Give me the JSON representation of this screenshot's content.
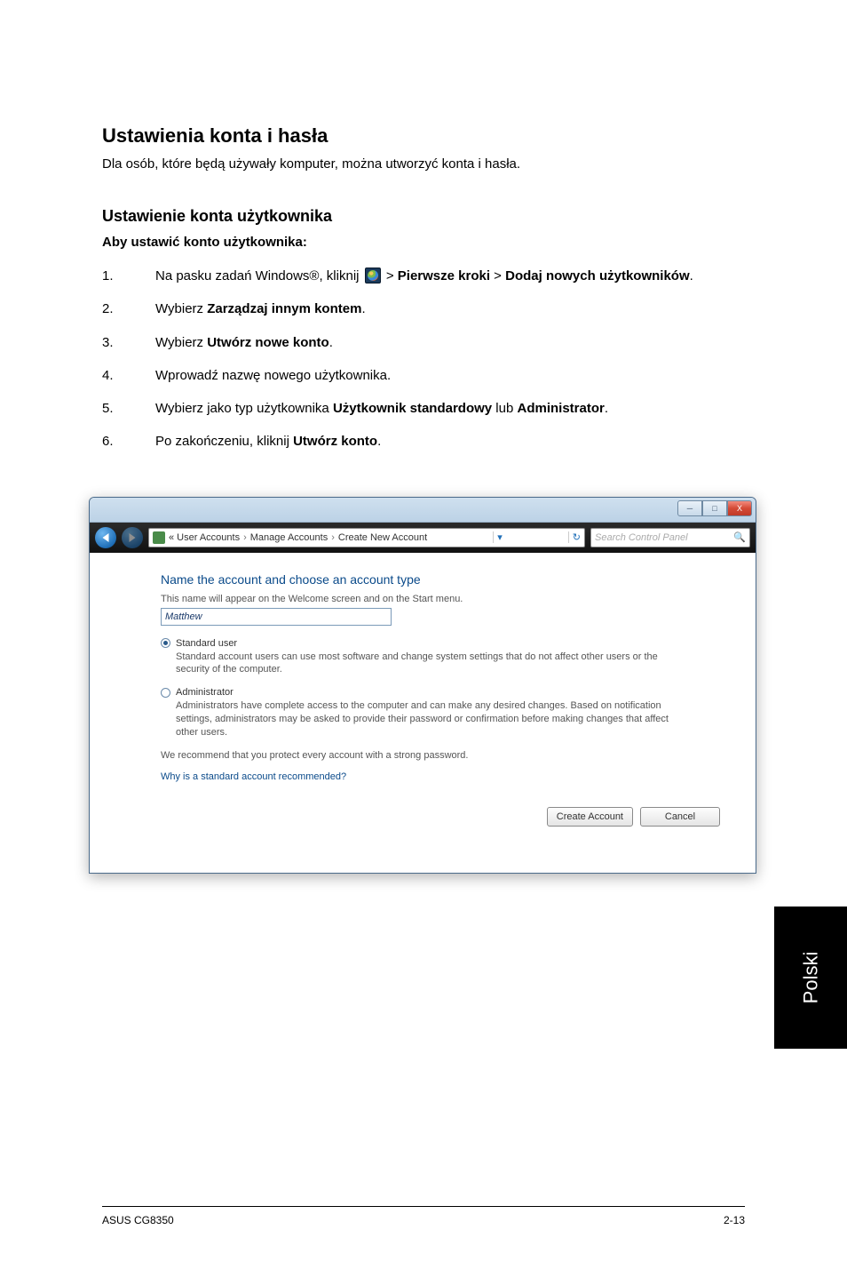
{
  "header": {
    "title": "Ustawienia konta i hasła",
    "intro": "Dla osób, które będą używały komputer, można utworzyć konta i hasła."
  },
  "section": {
    "title": "Ustawienie konta użytkownika",
    "subtitle": "Aby ustawić konto użytkownika:"
  },
  "steps": {
    "s1_a": "Na pasku zadań Windows®, kliknij ",
    "s1_b": " > ",
    "s1_bold1": "Pierwsze kroki",
    "s1_c": " > ",
    "s1_bold2": "Dodaj nowych użytkowników",
    "s1_d": ".",
    "s2_a": "Wybierz ",
    "s2_bold": "Zarządzaj innym kontem",
    "s2_b": ".",
    "s3_a": "Wybierz ",
    "s3_bold": "Utwórz nowe konto",
    "s3_b": ".",
    "s4": "Wprowadź nazwę nowego użytkownika.",
    "s5_a": "Wybierz jako typ użytkownika ",
    "s5_bold1": "Użytkownik standardowy",
    "s5_b": " lub ",
    "s5_bold2": "Administrator",
    "s5_c": ".",
    "s6_a": "Po zakończeniu, kliknij ",
    "s6_bold": "Utwórz konto",
    "s6_b": "."
  },
  "nums": {
    "n1": "1.",
    "n2": "2.",
    "n3": "3.",
    "n4": "4.",
    "n5": "5.",
    "n6": "6."
  },
  "dialog": {
    "titlebar": {
      "min": "─",
      "max": "□",
      "close": "X"
    },
    "breadcrumb": {
      "a": "« User Accounts",
      "b": "Manage Accounts",
      "c": "Create New Account",
      "sep": "›",
      "refresh": "↻",
      "dd": "▾"
    },
    "search": {
      "placeholder": "Search Control Panel",
      "icon": "🔍"
    },
    "heading": "Name the account and choose an account type",
    "sub": "This name will appear on the Welcome screen and on the Start menu.",
    "input_value": "Matthew",
    "standard": {
      "label": "Standard user",
      "desc": "Standard account users can use most software and change system settings that do not affect other users or the security of the computer."
    },
    "admin": {
      "label": "Administrator",
      "desc": "Administrators have complete access to the computer and can make any desired changes. Based on notification settings, administrators may be asked to provide their password or confirmation before making changes that affect other users."
    },
    "recommend": "We recommend that you protect every account with a strong password.",
    "link": "Why is a standard account recommended?",
    "btn_create": "Create Account",
    "btn_cancel": "Cancel"
  },
  "chrome": {
    "side_tab": "Polski",
    "footer_left": "ASUS CG8350",
    "footer_right": "2-13"
  }
}
